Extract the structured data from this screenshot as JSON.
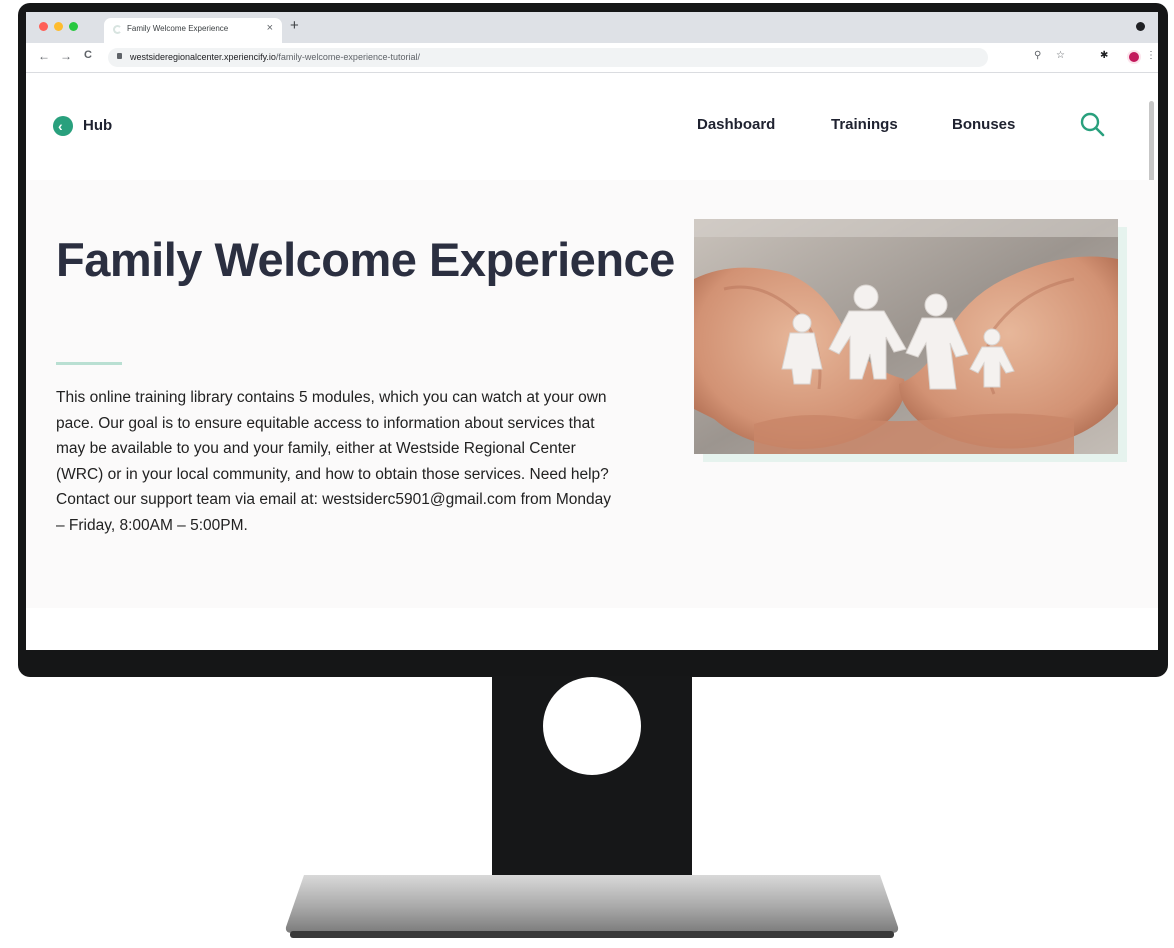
{
  "browser": {
    "tab_title": "Family Welcome Experience",
    "tab_close": "×",
    "new_tab": "+",
    "back": "←",
    "forward": "→",
    "reload": "C",
    "url_host": "westsideregionalcenter.xperiencify.io",
    "url_path": "/family-welcome-experience-tutorial/",
    "zoom_icon": "⚲",
    "star_icon": "☆",
    "extensions_icon": "✱",
    "menu_icon": "⋮"
  },
  "header": {
    "back_arrow": "‹",
    "back_label": "Hub",
    "nav": [
      "Dashboard",
      "Trainings",
      "Bonuses"
    ]
  },
  "hero": {
    "title": "Family Welcome Experience",
    "description": "This online training library contains 5 modules, which you can watch at your own pace. Our goal is to ensure equitable access to information about services that may be available to you and your family, either at  Westside Regional Center (WRC)  or in your local community, and how to obtain those services.   Need help? Contact our support team via email at: westsiderc5901@gmail.com from Monday – Friday, 8:00AM – 5:00PM."
  },
  "colors": {
    "accent": "#29a07d",
    "heading": "#2b2f40",
    "monitor": "#151617"
  },
  "icons": {
    "hub": "chevron-left-icon",
    "search": "search-icon",
    "photo": "hands-holding-paper-family-image"
  }
}
